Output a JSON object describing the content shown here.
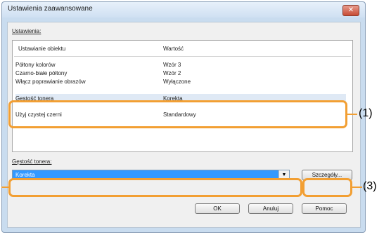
{
  "window": {
    "title": "Ustawienia zaawansowane",
    "close_glyph": "✕"
  },
  "settings_label": "Ustawienia:",
  "table": {
    "headers": [
      "Ustawianie obiektu",
      "Wartość"
    ],
    "rows": [
      {
        "name": "Półtony kolorów",
        "value": "Wzór 3"
      },
      {
        "name": "Czarno-białe półtony",
        "value": "Wzór 2"
      },
      {
        "name": "Włącz poprawianie obrazów",
        "value": "Wyłączone"
      },
      {
        "name": "Gęstość tonera",
        "value": "Korekta"
      },
      {
        "name": "Użyj czystej czerni",
        "value": "Standardowy"
      }
    ]
  },
  "toner_label": "Gęstość tonera:",
  "dropdown": {
    "value": "Korekta",
    "arrow": "▼"
  },
  "buttons": {
    "details": "Szczegóły...",
    "ok": "OK",
    "cancel": "Anuluj",
    "help": "Pomoc"
  },
  "callouts": {
    "c1": "(1)",
    "c3": "(3)"
  },
  "colors": {
    "accent": "#f29f33",
    "selection": "#3399ff"
  }
}
